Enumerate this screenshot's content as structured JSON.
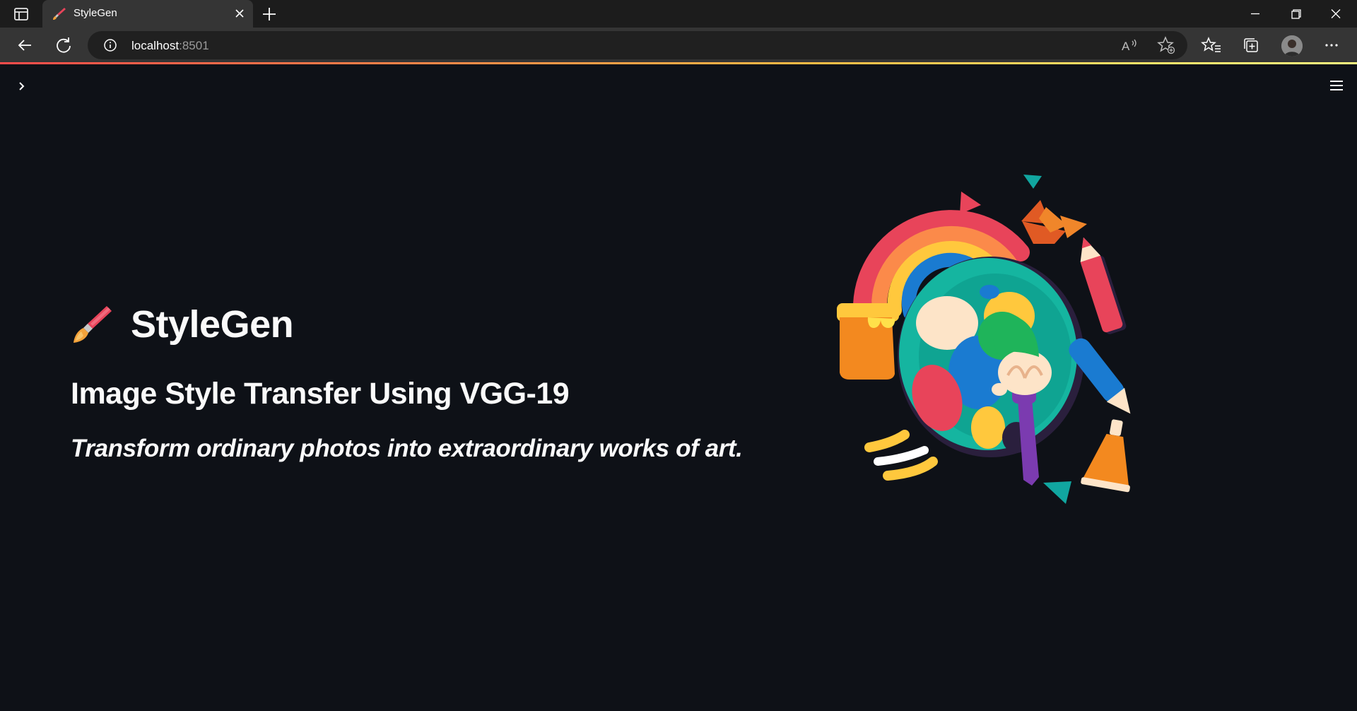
{
  "browser": {
    "tab_title": "StyleGen",
    "url_host": "localhost",
    "url_port": ":8501"
  },
  "app": {
    "title": "StyleGen",
    "subtitle": "Image Style Transfer Using VGG-19",
    "tagline": "Transform ordinary photos into extraordinary works of art.",
    "title_emoji": "paintbrush-emoji",
    "illustration": "paint-palette-illustration"
  },
  "colors": {
    "background": "#0e1117",
    "text": "#fafafa",
    "accent_gradient_start": "#ff4b4b",
    "accent_gradient_end": "#fffd80"
  }
}
